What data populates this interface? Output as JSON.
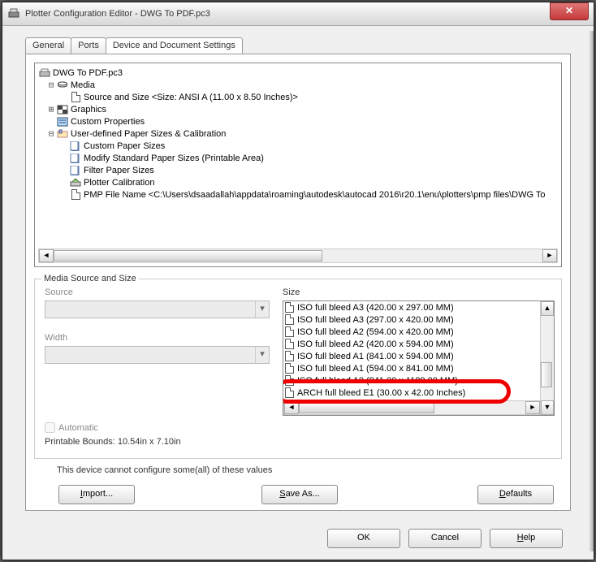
{
  "window": {
    "title": "Plotter Configuration Editor - DWG To PDF.pc3"
  },
  "tabs": {
    "general": "General",
    "ports": "Ports",
    "device": "Device and Document Settings"
  },
  "tree": {
    "root": "DWG To PDF.pc3",
    "media": "Media",
    "source_size": "Source and Size <Size: ANSI A (11.00 x 8.50 Inches)>",
    "graphics": "Graphics",
    "custom_props": "Custom Properties",
    "udps": "User-defined Paper Sizes & Calibration",
    "custom_paper": "Custom Paper Sizes",
    "modify_std": "Modify Standard Paper Sizes (Printable Area)",
    "filter": "Filter Paper Sizes",
    "plot_calib": "Plotter Calibration",
    "pmp": "PMP File Name <C:\\Users\\dsaadallah\\appdata\\roaming\\autodesk\\autocad 2016\\r20.1\\enu\\plotters\\pmp files\\DWG To"
  },
  "media": {
    "group": "Media Source and Size",
    "source": "Source",
    "width": "Width",
    "size": "Size",
    "automatic": "Automatic",
    "bounds": "Printable Bounds: 10.54in x 7.10in",
    "items": [
      "ISO full bleed A3 (420.00 x 297.00 MM)",
      "ISO full bleed A3 (297.00 x 420.00 MM)",
      "ISO full bleed A2 (594.00 x 420.00 MM)",
      "ISO full bleed A2 (420.00 x 594.00 MM)",
      "ISO full bleed A1 (841.00 x 594.00 MM)",
      "ISO full bleed A1 (594.00 x 841.00 MM)",
      "ISO full bleed A0 (841.00 x 1189.00 MM)",
      "ARCH full bleed E1 (30.00 x 42.00 Inches)"
    ]
  },
  "note": "This device cannot configure some(all) of these values",
  "buttons": {
    "import": "Import...",
    "import_u": "I",
    "saveas": "Save As...",
    "saveas_u": "S",
    "defaults": "Defaults",
    "defaults_u": "D",
    "ok": "OK",
    "cancel": "Cancel",
    "help": "Help",
    "help_u": "H"
  }
}
